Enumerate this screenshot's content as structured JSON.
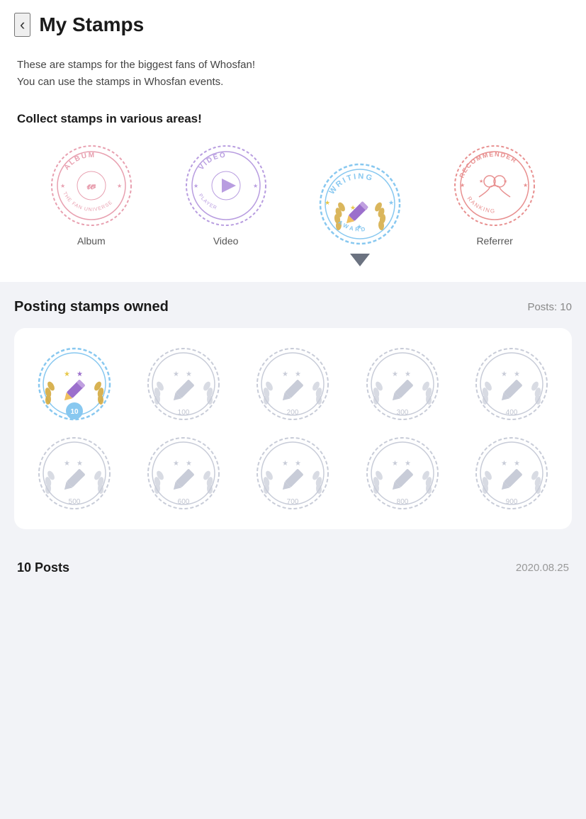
{
  "header": {
    "back_label": "‹",
    "title": "My Stamps"
  },
  "description": {
    "line1": "These are stamps for the biggest fans of Whosfan!",
    "line2": "You can use the stamps in Whosfan events."
  },
  "collect": {
    "title": "Collect stamps in various areas!",
    "stamps": [
      {
        "id": "album",
        "label": "Album",
        "active": false
      },
      {
        "id": "video",
        "label": "Video",
        "active": false
      },
      {
        "id": "writing",
        "label": "Writing",
        "active": true
      },
      {
        "id": "referrer",
        "label": "Referrer",
        "active": false
      }
    ]
  },
  "detail": {
    "title": "Posting stamps owned",
    "posts_label": "Posts: 10",
    "grid": [
      {
        "value": 10,
        "active": true
      },
      {
        "value": 100,
        "active": false
      },
      {
        "value": 200,
        "active": false
      },
      {
        "value": 300,
        "active": false
      },
      {
        "value": 400,
        "active": false
      },
      {
        "value": 500,
        "active": false
      },
      {
        "value": 600,
        "active": false
      },
      {
        "value": 700,
        "active": false
      },
      {
        "value": 800,
        "active": false
      },
      {
        "value": 900,
        "active": false
      }
    ]
  },
  "footer": {
    "posts_text": "10 Posts",
    "date_text": "2020.08.25"
  },
  "colors": {
    "album_ring": "#e8a0b0",
    "video_ring": "#b89de0",
    "writing_ring": "#88c8f0",
    "referrer_ring": "#e89090",
    "active_stamp_blue": "#7ec8f0",
    "inactive_stamp": "#d0d4de",
    "gold": "#d4aa40",
    "purple": "#9b6fcc"
  }
}
